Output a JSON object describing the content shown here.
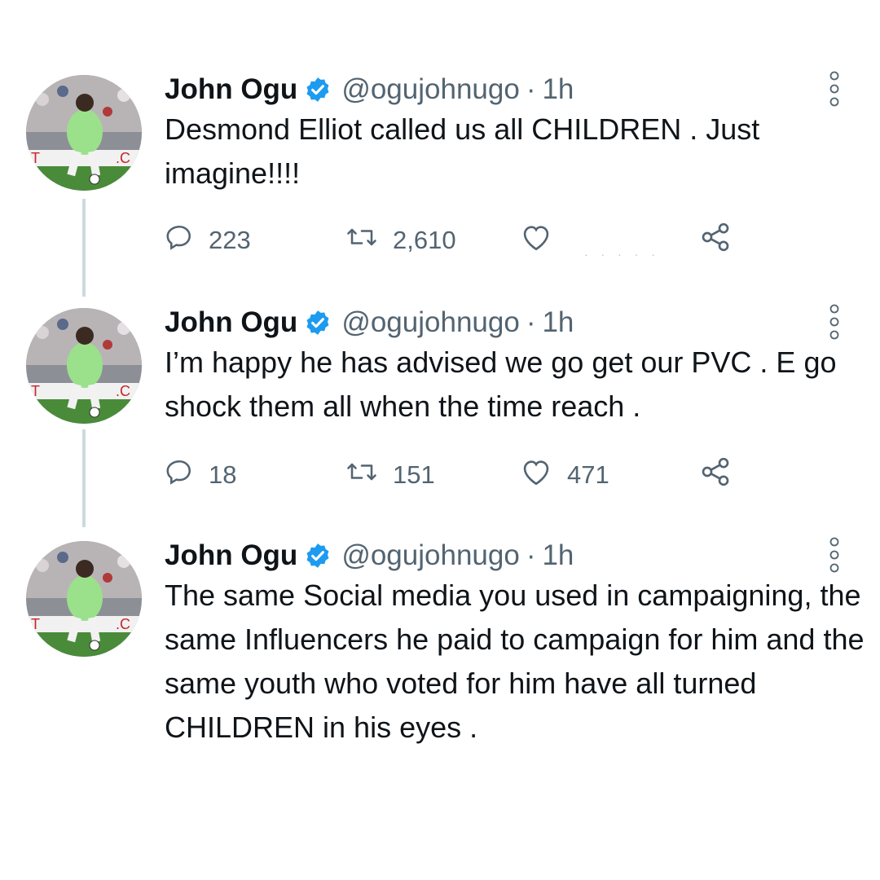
{
  "tweets": [
    {
      "author": "John Ogu",
      "handle": "@ogujohnugo",
      "separator": "·",
      "time": "1h",
      "text": "Desmond Elliot called us all CHILDREN . Just imagine!!!!",
      "replies": "223",
      "retweets": "2,610",
      "likes": ""
    },
    {
      "author": "John Ogu",
      "handle": "@ogujohnugo",
      "separator": "·",
      "time": "1h",
      "text": "I’m happy he has advised we go get our PVC . E go shock them all when the time reach .",
      "replies": "18",
      "retweets": "151",
      "likes": "471"
    },
    {
      "author": "John Ogu",
      "handle": "@ogujohnugo",
      "separator": "·",
      "time": "1h",
      "text": "The same Social media you used in campaigning, the same Influencers he paid to campaign for him and the same youth who voted for him have all turned CHILDREN in his eyes ."
    }
  ],
  "icons": {
    "verified": "verified-badge-icon",
    "more": "more-vertical-icon",
    "reply": "reply-icon",
    "retweet": "retweet-icon",
    "like": "heart-icon",
    "share": "share-icon"
  },
  "colors": {
    "verified": "#1d9bf0",
    "secondary_text": "#536471",
    "thread_line": "#cfd9de"
  }
}
